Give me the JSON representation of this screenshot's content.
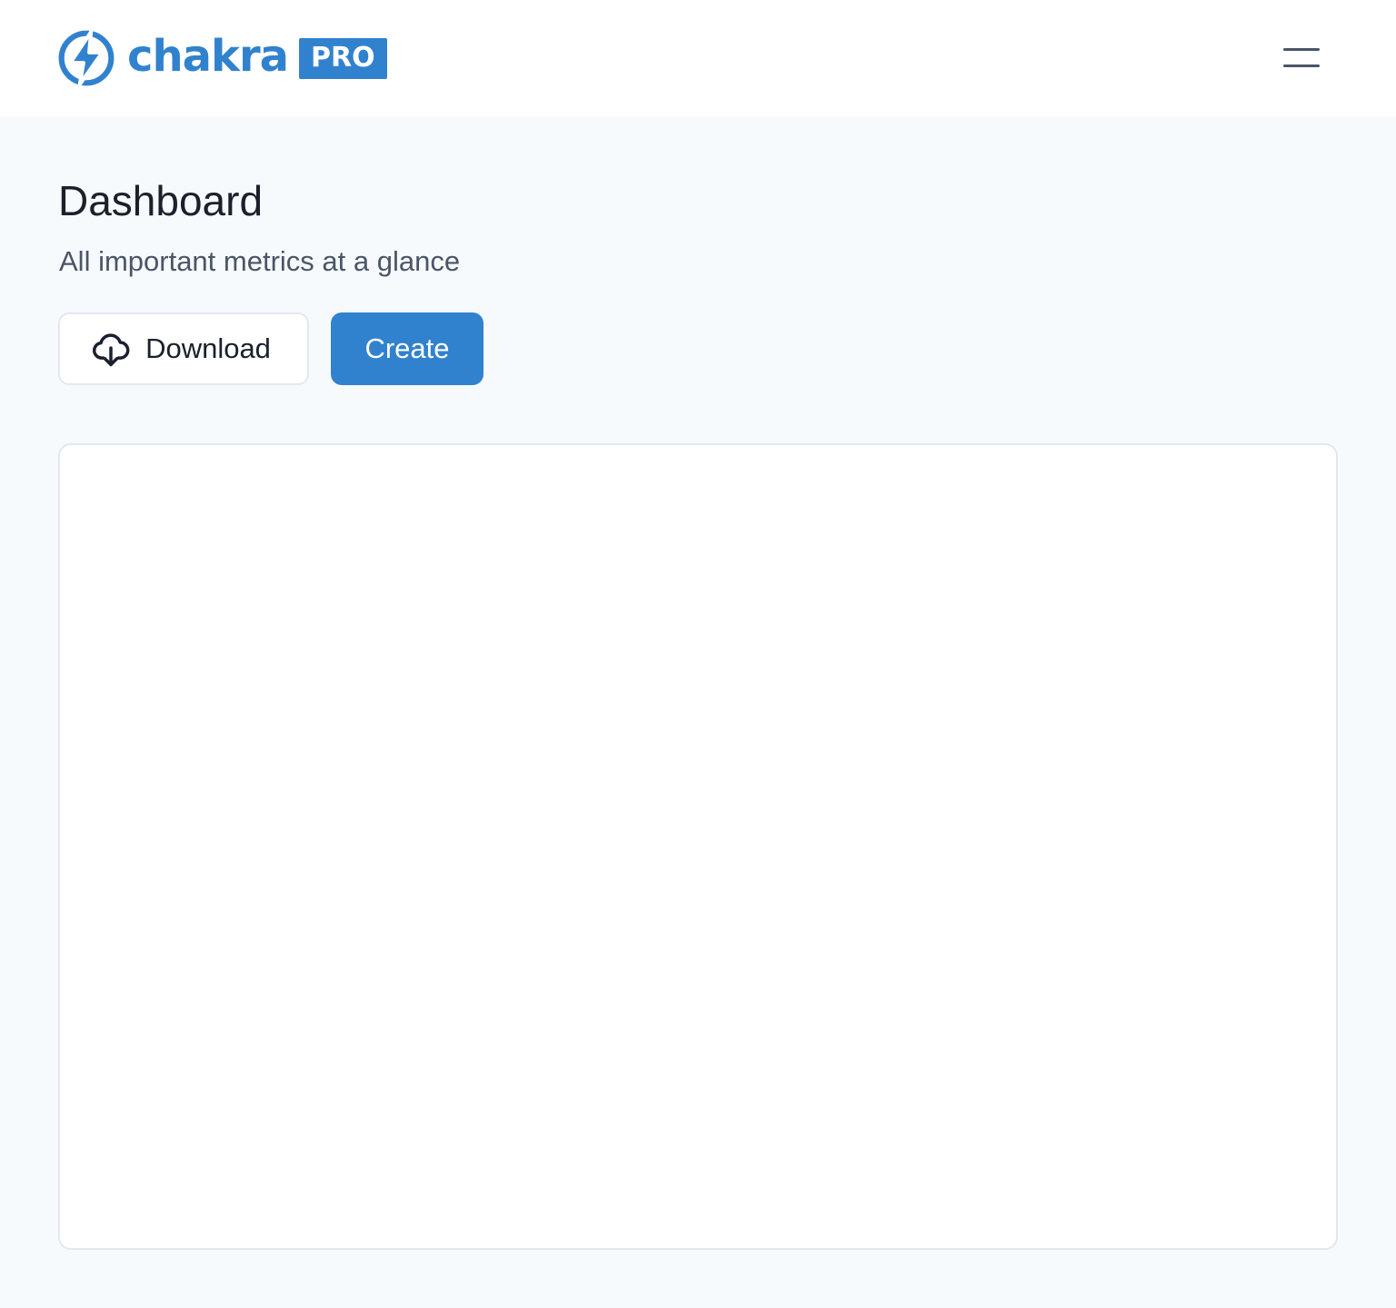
{
  "header": {
    "logo": {
      "wordmark": "chakra",
      "badge": "PRO",
      "icon": "bolt-circle-icon"
    },
    "menu_icon": "hamburger-menu-icon"
  },
  "page": {
    "title": "Dashboard",
    "subtitle": "All important metrics at a glance"
  },
  "actions": {
    "download_label": "Download",
    "download_icon": "cloud-download-icon",
    "create_label": "Create"
  },
  "colors": {
    "brand": "#3182ce",
    "background": "#f7fafc",
    "surface": "#ffffff",
    "border": "#e2e8f0",
    "text": "#1a202c",
    "muted_text": "#4a5568"
  }
}
